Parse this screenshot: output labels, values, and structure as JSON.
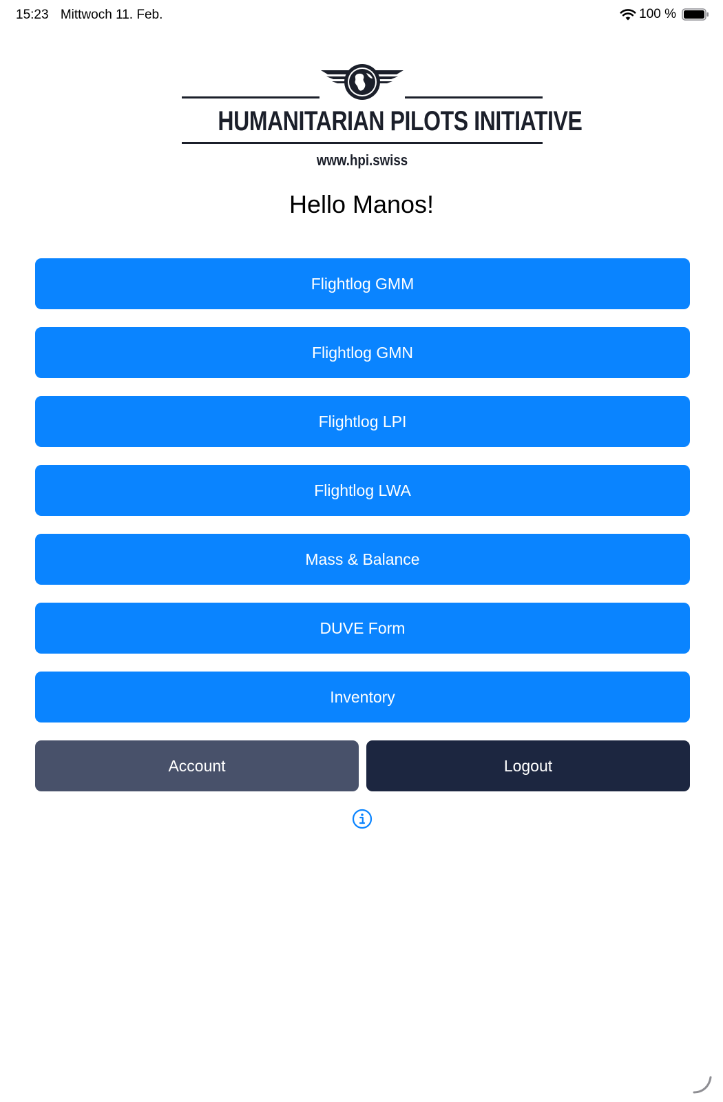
{
  "status_bar": {
    "time": "15:23",
    "date": "Mittwoch 11. Feb.",
    "battery_percent": "100 %"
  },
  "logo": {
    "title": "HUMANITARIAN PILOTS INITIATIVE",
    "url": "www.hpi.swiss"
  },
  "greeting": "Hello Manos!",
  "menu": {
    "items": [
      {
        "label": "Flightlog GMM"
      },
      {
        "label": "Flightlog GMN"
      },
      {
        "label": "Flightlog LPI"
      },
      {
        "label": "Flightlog LWA"
      },
      {
        "label": "Mass & Balance"
      },
      {
        "label": "DUVE Form"
      },
      {
        "label": "Inventory"
      }
    ]
  },
  "actions": {
    "account_label": "Account",
    "logout_label": "Logout"
  },
  "colors": {
    "primary": "#0a84ff",
    "account": "#48516a",
    "logout": "#1c2640"
  },
  "icons": {
    "wifi": "wifi-icon",
    "battery": "battery-icon",
    "info": "info-icon",
    "emblem": "globe-wings-icon"
  }
}
